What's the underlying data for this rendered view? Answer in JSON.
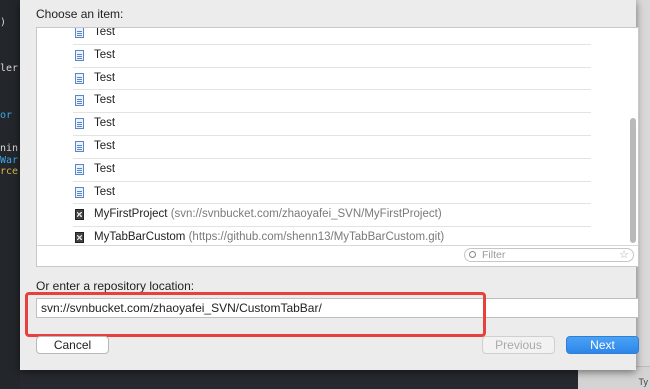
{
  "background": {
    "code_lines": [
      {
        "text": ")",
        "color": "white"
      },
      {
        "text": "ler",
        "color": "white"
      },
      {
        "text": "or",
        "color": "blue"
      },
      {
        "text": "nin",
        "color": "white"
      },
      {
        "text": "War",
        "color": "blue"
      },
      {
        "text": "rce",
        "color": "yellow"
      }
    ],
    "corner_text": "Ty"
  },
  "dialog": {
    "choose_label": "Choose an item:",
    "items": [
      {
        "name": "Test",
        "url": "",
        "icon": "document-icon"
      },
      {
        "name": "Test",
        "url": "",
        "icon": "document-icon"
      },
      {
        "name": "Test",
        "url": "",
        "icon": "document-icon"
      },
      {
        "name": "Test",
        "url": "",
        "icon": "document-icon"
      },
      {
        "name": "Test",
        "url": "",
        "icon": "document-icon"
      },
      {
        "name": "Test",
        "url": "",
        "icon": "document-icon"
      },
      {
        "name": "Test",
        "url": "",
        "icon": "document-icon"
      },
      {
        "name": "Test",
        "url": "",
        "icon": "document-icon"
      },
      {
        "name": "MyFirstProject",
        "url": "(svn://svnbucket.com/zhaoyafei_SVN/MyFirstProject)",
        "icon": "repository-icon"
      },
      {
        "name": "MyTabBarCustom",
        "url": "(https://github.com/shenn13/MyTabBarCustom.git)",
        "icon": "repository-icon"
      }
    ],
    "filter_placeholder": "Filter",
    "repo_label": "Or enter a repository location:",
    "repo_value": "svn://svnbucket.com/zhaoyafei_SVN/CustomTabBar/",
    "buttons": {
      "cancel": "Cancel",
      "previous": "Previous",
      "next": "Next"
    }
  },
  "colors": {
    "accent": "#2d86e8",
    "highlight_box": "#e8403c"
  }
}
